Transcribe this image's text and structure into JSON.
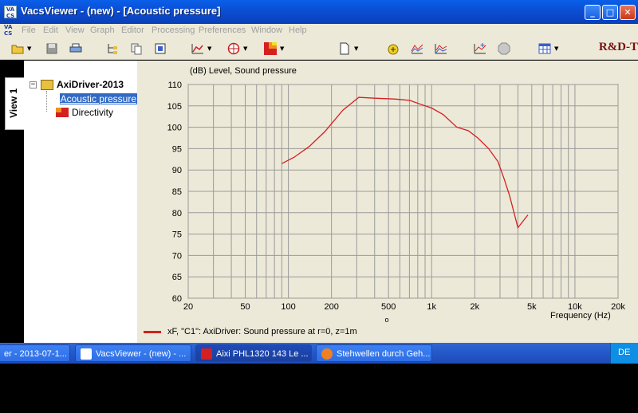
{
  "window": {
    "title": "VacsViewer - (new) - [Acoustic pressure]",
    "logo_text": "VA CS",
    "controls": {
      "minimize": "_",
      "maximize": "□",
      "close": "✕"
    }
  },
  "menu": {
    "items": [
      "File",
      "Edit",
      "View",
      "Graph",
      "Editor",
      "Processing",
      "Preferences",
      "Window",
      "Help"
    ]
  },
  "toolbar": {
    "icons": [
      "open-folder-icon",
      "save-icon",
      "print-icon",
      "tree-icon",
      "copy-icon",
      "export-icon",
      "curve-icon",
      "polar-icon",
      "map-icon",
      "new-page-icon",
      "add-icon",
      "spectrum-icon",
      "waterfall-icon",
      "chart-add-icon",
      "stop-icon",
      "table-icon"
    ],
    "brand": "R&D-T"
  },
  "sidetab": {
    "label": "View 1"
  },
  "tree": {
    "expander": "−",
    "root": "AxiDriver-2013",
    "children": [
      {
        "label": "Acoustic pressure",
        "selected": true,
        "icon": "curve-icon"
      },
      {
        "label": "Directivity",
        "selected": false,
        "icon": "directivity-map-icon"
      }
    ]
  },
  "plot": {
    "ylabel": "(dB)  Level, Sound pressure",
    "xlabel": "Frequency  (Hz)",
    "legend": "xF, \"C1\": AxiDriver: Sound pressure at r=0, z=1m",
    "extra_mark": "o",
    "line_color": "#d42020",
    "bg_color": "#ece9d8"
  },
  "chart_data": {
    "type": "line",
    "xscale": "log",
    "xlim": [
      20,
      20000
    ],
    "ylim": [
      60,
      110
    ],
    "x_ticks": [
      20,
      50,
      100,
      200,
      500,
      1000,
      2000,
      5000,
      10000,
      20000
    ],
    "x_tick_labels": [
      "20",
      "50",
      "100",
      "200",
      "500",
      "1k",
      "2k",
      "5k",
      "10k",
      "20k"
    ],
    "y_ticks": [
      60,
      65,
      70,
      75,
      80,
      85,
      90,
      95,
      100,
      105,
      110
    ],
    "y_tick_labels": [
      "60",
      "65",
      "70",
      "75",
      "80",
      "85",
      "90",
      "95",
      "100",
      "105",
      "110"
    ],
    "grid": true,
    "series": [
      {
        "name": "xF, \"C1\": AxiDriver: Sound pressure at r=0, z=1m",
        "color": "#d42020",
        "x": [
          90,
          110,
          140,
          180,
          240,
          310,
          400,
          550,
          700,
          850,
          1000,
          1200,
          1500,
          1800,
          2100,
          2500,
          2900,
          3200,
          3500,
          4000,
          4700
        ],
        "y": [
          91.5,
          93,
          95.5,
          99,
          104,
          107,
          106.8,
          106.6,
          106.3,
          105.3,
          104.5,
          103,
          100,
          99.2,
          97.5,
          95,
          92,
          88,
          84,
          76.5,
          79.5
        ]
      }
    ]
  },
  "taskbar": {
    "tasks": [
      {
        "label": "er - 2013-07-1...",
        "active": false
      },
      {
        "label": "VacsViewer - (new) - ...",
        "active": false
      },
      {
        "label": "Aixi PHL1320 143 Le ...",
        "active": true
      },
      {
        "label": "Stehwellen durch Geh...",
        "active": false
      }
    ],
    "tray_lang": "DE"
  }
}
